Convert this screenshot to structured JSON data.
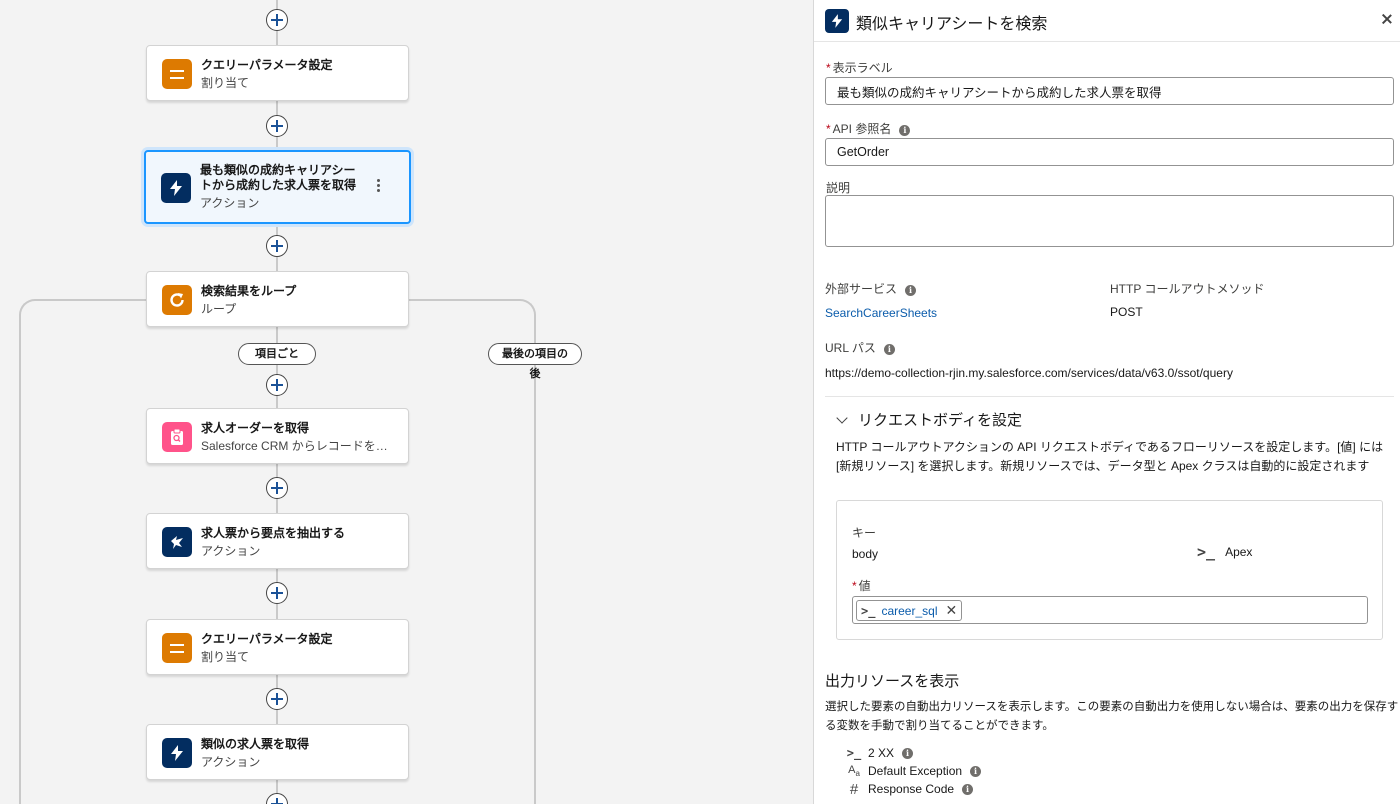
{
  "canvas": {
    "nodes": [
      {
        "title": "クエリーパラメータ設定",
        "subtitle": "割り当て",
        "icon": "assignment-icon"
      },
      {
        "title": "最も類似の成約キャリアシートから成約した求人票を取得",
        "subtitle": "アクション",
        "icon": "lightning-icon"
      },
      {
        "title": "検索結果をループ",
        "subtitle": "ループ",
        "icon": "loop-icon"
      },
      {
        "title": "求人オーダーを取得",
        "subtitle": "Salesforce CRM からレコードを…",
        "icon": "get-records-icon"
      },
      {
        "title": "求人票から要点を抽出する",
        "subtitle": "アクション",
        "icon": "prompt-template-icon"
      },
      {
        "title": "クエリーパラメータ設定",
        "subtitle": "割り当て",
        "icon": "assignment-icon"
      },
      {
        "title": "類似の求人票を取得",
        "subtitle": "アクション",
        "icon": "lightning-icon"
      }
    ],
    "loop_labels": {
      "for_each": "項目ごと",
      "after_last": "最後の項目の後"
    }
  },
  "panel": {
    "title": "類似キャリアシートを検索",
    "label_field": {
      "label": "表示ラベル",
      "value": "最も類似の成約キャリアシートから成約した求人票を取得"
    },
    "api_field": {
      "label": "API 参照名",
      "value": "GetOrder"
    },
    "description_field": {
      "label": "説明",
      "value": ""
    },
    "external_service": {
      "label": "外部サービス",
      "value": "SearchCareerSheets"
    },
    "http_method": {
      "label": "HTTP コールアウトメソッド",
      "value": "POST"
    },
    "url_path": {
      "label": "URL パス",
      "value": "https://demo-collection-rjin.my.salesforce.com/services/data/v63.0/ssot/query"
    },
    "request_body": {
      "heading": "リクエストボディを設定",
      "description": "HTTP コールアウトアクションの API リクエストボディであるフローリソースを設定します。[値] には [新規リソース] を選択します。新規リソースでは、データ型と Apex クラスは自動的に設定されます",
      "key_label": "キー",
      "key_value": "body",
      "type_value": "Apex",
      "value_label": "値",
      "value_tag": "career_sql"
    },
    "outputs": {
      "heading": "出力リソースを表示",
      "description": "選択した要素の自動出力リソースを表示します。この要素の自動出力を使用しない場合は、要素の出力を保存する変数を手動で割り当てることができます。",
      "items": [
        {
          "icon": "apex-icon",
          "label": "2 XX"
        },
        {
          "icon": "text-icon",
          "label": "Default Exception"
        },
        {
          "icon": "number-icon",
          "label": "Response Code"
        }
      ]
    }
  }
}
